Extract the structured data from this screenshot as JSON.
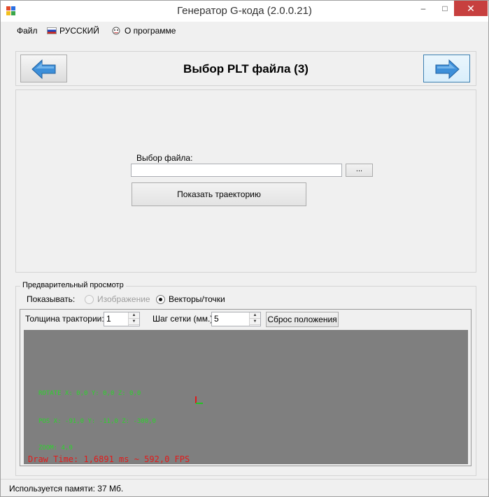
{
  "window": {
    "title": "Генератор G-кода (2.0.0.21)",
    "controls": {
      "minimize": "–",
      "maximize": "□",
      "close": "✕"
    }
  },
  "menu": {
    "file": "Файл",
    "language": "РУССКИЙ",
    "about": "О программе"
  },
  "header": {
    "title": "Выбор PLT файла (3)",
    "back_icon": "arrow-left-icon",
    "forward_icon": "arrow-right-icon"
  },
  "file_select": {
    "label": "Выбор файла:",
    "value": "",
    "browse_label": "...",
    "show_button": "Показать траекторию"
  },
  "preview": {
    "legend": "Предварительный просмотр",
    "show_label": "Показывать:",
    "options": [
      {
        "label": "Изображение",
        "checked": false,
        "enabled": false
      },
      {
        "label": "Векторы/точки",
        "checked": true,
        "enabled": true
      }
    ],
    "thickness_label": "Толщина трактории:",
    "thickness_value": "1",
    "grid_label": "Шаг сетки (мм.):",
    "grid_value": "5",
    "reset_button": "Сброс положения",
    "overlay": {
      "rotate": "ROTATE X: 0,0  Y: 0,0 Z: 0,0",
      "pos": "POS X: -91,0  Y: -11,0 Z: -300,0",
      "zoom": "ZOOM: 4,0",
      "draw_time": "Draw Time: 1,6891 ms ~ 592,0 FPS"
    },
    "canvas_color": "#7f7f7f"
  },
  "status": {
    "memory": "Используется памяти:  37  Мб."
  }
}
